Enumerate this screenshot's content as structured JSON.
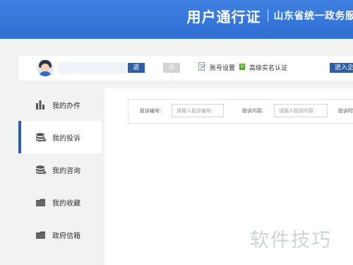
{
  "header": {
    "title": "用户通行证",
    "subtitle": "山东省统一政务服务"
  },
  "user_bar": {
    "back_label": "返回",
    "exit_label": "退出",
    "settings_label": "账号设置",
    "auth_badge": "V",
    "auth_label": "高级实名认证",
    "enter_label": "进入企"
  },
  "sidebar": {
    "items": [
      {
        "label": "我的办件",
        "icon": "bar-chart-icon"
      },
      {
        "label": "我的投诉",
        "icon": "database-icon",
        "active": true
      },
      {
        "label": "我的咨询",
        "icon": "database-icon"
      },
      {
        "label": "我的收藏",
        "icon": "folder-icon"
      },
      {
        "label": "政府信箱",
        "icon": "mailbox-icon"
      }
    ]
  },
  "filters": {
    "complaint_no_label": "投诉编号:",
    "complaint_no_placeholder": "请输入投诉编号",
    "content_label": "投诉内容:",
    "content_placeholder": "请输入投诉内容",
    "third_label": "投诉时"
  },
  "watermark": "软件技巧",
  "colors": {
    "header_blue": "#3f80e0",
    "button_blue": "#2f5ea8",
    "active_bar": "#2f5ea8",
    "verified_green": "#4caf1f"
  }
}
